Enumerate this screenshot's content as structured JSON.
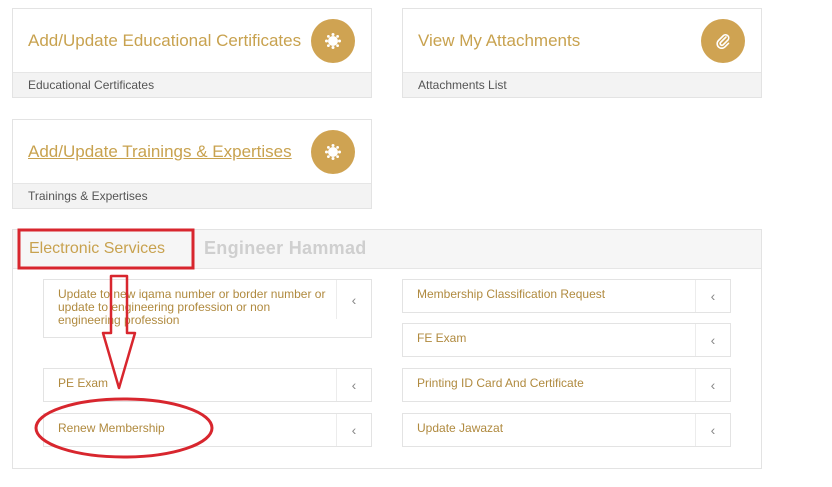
{
  "cards": [
    {
      "title": "Add/Update Educational Certificates",
      "footer": "Educational Certificates",
      "icon": "gear-icon"
    },
    {
      "title": "View My Attachments",
      "footer": "Attachments List",
      "icon": "paperclip-icon"
    },
    {
      "title": "Add/Update Trainings & Expertises",
      "footer": "Trainings & Expertises",
      "icon": "gear-icon"
    }
  ],
  "section": {
    "title": "Electronic Services",
    "watermark": "Engineer Hammad"
  },
  "services": {
    "left": [
      "Update to new iqama number or border number or update to engineering profession or non engineering profession",
      "PE Exam",
      "Renew Membership"
    ],
    "right": [
      "Membership Classification Request",
      "FE Exam",
      "Printing ID Card And Certificate",
      "Update Jawazat"
    ]
  },
  "chevron_glyph": "‹",
  "colors": {
    "accent": "#c8a24f",
    "icon_circle": "#cfa352",
    "annotation": "#d8262e"
  }
}
